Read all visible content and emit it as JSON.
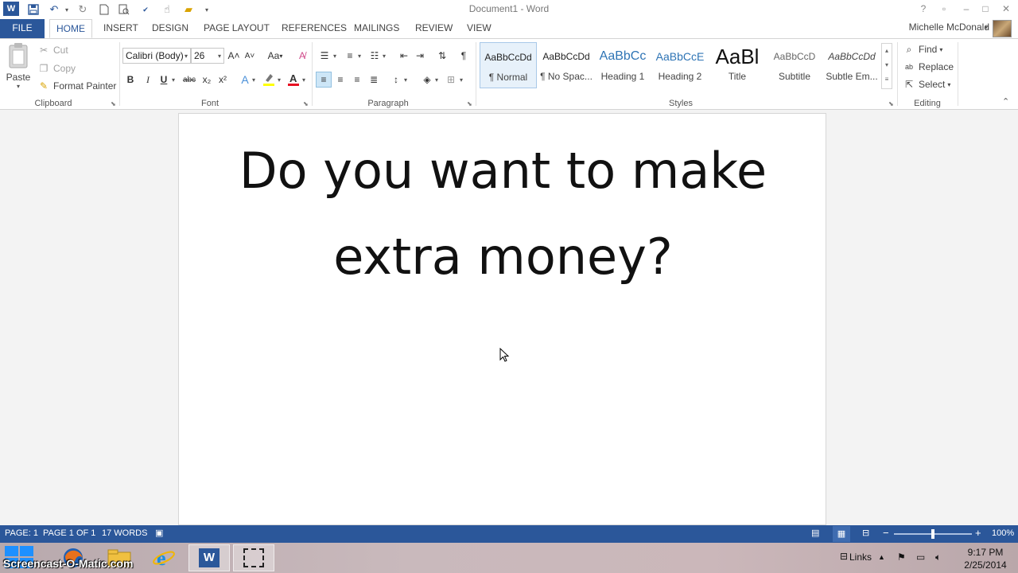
{
  "window": {
    "title": "Document1 - Word",
    "user_name": "Michelle McDonald",
    "controls": [
      "?",
      "restore",
      "–",
      "□",
      "✕"
    ]
  },
  "tabs": [
    "FILE",
    "HOME",
    "INSERT",
    "DESIGN",
    "PAGE LAYOUT",
    "REFERENCES",
    "MAILINGS",
    "REVIEW",
    "VIEW"
  ],
  "active_tab": "HOME",
  "clipboard": {
    "paste": "Paste",
    "cut": "Cut",
    "copy": "Copy",
    "format_painter": "Format Painter",
    "label": "Clipboard"
  },
  "font": {
    "name": "Calibri (Body)",
    "size": "26",
    "label": "Font",
    "bold": "B",
    "italic": "I",
    "underline": "U",
    "strike": "abc",
    "sub": "x₂",
    "sup": "x²",
    "grow": "A˄",
    "shrink": "A˅",
    "case": "Aa",
    "font_color": "#e81123",
    "highlight_color": "#ffff00"
  },
  "paragraph": {
    "label": "Paragraph",
    "show_marks": "¶"
  },
  "styles": {
    "label": "Styles",
    "items": [
      {
        "preview": "AaBbCcDd",
        "name": "¶ Normal"
      },
      {
        "preview": "AaBbCcDd",
        "name": "¶ No Spac..."
      },
      {
        "preview": "AaBbCc",
        "name": "Heading 1"
      },
      {
        "preview": "AaBbCcE",
        "name": "Heading 2"
      },
      {
        "preview": "AaBl",
        "name": "Title"
      },
      {
        "preview": "AaBbCcD",
        "name": "Subtitle"
      },
      {
        "preview": "AaBbCcDd",
        "name": "Subtle Em..."
      }
    ]
  },
  "editing": {
    "label": "Editing",
    "find": "Find",
    "replace": "Replace",
    "select": "Select"
  },
  "document": {
    "line1": "Do you want to make",
    "line2": "extra money?"
  },
  "status": {
    "page": "PAGE: 1",
    "page_of": "PAGE 1 OF 1",
    "words": "17 WORDS",
    "zoom": "100%",
    "zoom_level": 0.5
  },
  "taskbar": {
    "links": "Links",
    "time": "9:17 PM",
    "date": "2/25/2014",
    "watermark": "Screencast-O-Matic.com"
  },
  "colors": {
    "accent": "#2b579a",
    "heading": "#2e74b5"
  }
}
